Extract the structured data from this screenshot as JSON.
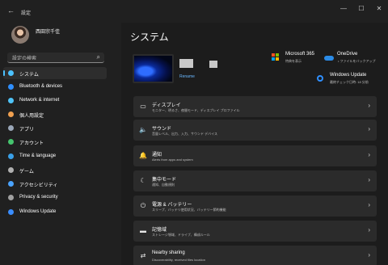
{
  "window": {
    "back_glyph": "←",
    "title": "設定",
    "controls": {
      "minimize": "—",
      "maximize": "☐",
      "close": "✕"
    }
  },
  "sidebar": {
    "user_name": "西田宗千佳",
    "search": {
      "value": "設定の検索",
      "icon": "search-icon"
    },
    "items": [
      {
        "label": "システム",
        "icon": "monitor-icon",
        "color": "#4cc2ff",
        "active": true
      },
      {
        "label": "Bluetooth & devices",
        "icon": "bluetooth-icon",
        "color": "#2f8fff",
        "active": false
      },
      {
        "label": "Network & internet",
        "icon": "wifi-icon",
        "color": "#4fc3f7",
        "active": false
      },
      {
        "label": "個人用設定",
        "icon": "brush-icon",
        "color": "#f0a050",
        "active": false
      },
      {
        "label": "アプリ",
        "icon": "apps-icon",
        "color": "#9aa7b8",
        "active": false
      },
      {
        "label": "アカウント",
        "icon": "person-icon",
        "color": "#45c46e",
        "active": false
      },
      {
        "label": "Time & language",
        "icon": "globe-icon",
        "color": "#3aa0e8",
        "active": false
      },
      {
        "label": "ゲーム",
        "icon": "gamepad-icon",
        "color": "#b0b0b0",
        "active": false
      },
      {
        "label": "アクセシビリティ",
        "icon": "accessibility-icon",
        "color": "#4aa3ff",
        "active": false
      },
      {
        "label": "Privacy & security",
        "icon": "shield-icon",
        "color": "#a0a0a0",
        "active": false
      },
      {
        "label": "Windows Update",
        "icon": "update-icon",
        "color": "#3a8dff",
        "active": false
      }
    ]
  },
  "main": {
    "page_title": "システム",
    "device": {
      "rename": "Rename"
    },
    "info": [
      {
        "title": "Microsoft 365",
        "sub": "特典を表示",
        "icon": "microsoft-365-icon"
      },
      {
        "title": "OneDrive",
        "sub": "• ファイルをバックアップ",
        "icon": "onedrive-icon"
      },
      {
        "title": "Windows Update",
        "sub": "最終チェック日時: 18 分前",
        "icon": "windows-update-icon"
      }
    ],
    "cards": [
      {
        "title": "ディスプレイ",
        "sub": "モニター、明るさ、夜間モード、ディスプレイ プロファイル",
        "icon": "display-icon",
        "glyph": "▭"
      },
      {
        "title": "サウンド",
        "sub": "音量レベル、出力、入力、サウンド デバイス",
        "icon": "speaker-icon",
        "glyph": "🔈"
      },
      {
        "title": "通知",
        "sub": "Alerts from apps and system",
        "icon": "bell-icon",
        "glyph": "🔔"
      },
      {
        "title": "集中モード",
        "sub": "通知、自動規則",
        "icon": "moon-icon",
        "glyph": "☾"
      },
      {
        "title": "電源 & バッテリー",
        "sub": "スリープ、バッテリ使用状況、バッテリー節約機能",
        "icon": "power-icon",
        "glyph": "⏻"
      },
      {
        "title": "記憶域",
        "sub": "ストレージ領域、ドライブ、構成ルール",
        "icon": "storage-icon",
        "glyph": "▬"
      },
      {
        "title": "Nearby sharing",
        "sub": "Discoverability, received files location",
        "icon": "share-icon",
        "glyph": "⇄"
      }
    ],
    "chevron": "›"
  }
}
